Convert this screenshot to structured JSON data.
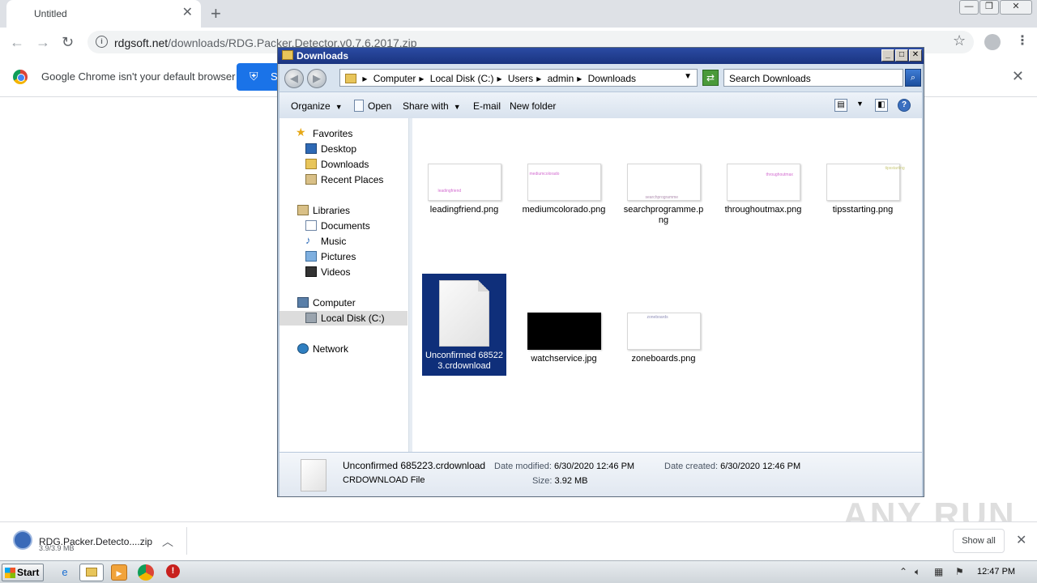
{
  "chrome": {
    "tab_title": "Untitled",
    "tab_close": "✕",
    "new_tab": "+",
    "url_host": "rdgsoft.net",
    "url_path": "/downloads/RDG.Packer.Detector.v0.7.6.2017.zip",
    "infobar_message": "Google Chrome isn't your default browser",
    "infobar_button": "S",
    "infobar_close": "✕",
    "win_minimize": "—",
    "win_restore": "❐",
    "win_close": "✕"
  },
  "download_shelf": {
    "file_name": "RDG.Packer.Detecto....zip",
    "file_size": "3.9/3.9 MB",
    "show_all": "Show all",
    "close": "✕"
  },
  "watermark": "ANY RUN",
  "explorer": {
    "title": "Downloads",
    "breadcrumb": [
      "Computer",
      "Local Disk (C:)",
      "Users",
      "admin",
      "Downloads"
    ],
    "search_placeholder": "Search Downloads",
    "toolbar": {
      "organize": "Organize",
      "open": "Open",
      "share_with": "Share with",
      "email": "E-mail",
      "new_folder": "New folder"
    },
    "nav": {
      "favorites": "Favorites",
      "desktop": "Desktop",
      "downloads": "Downloads",
      "recent_places": "Recent Places",
      "libraries": "Libraries",
      "documents": "Documents",
      "music": "Music",
      "pictures": "Pictures",
      "videos": "Videos",
      "computer": "Computer",
      "local_disk": "Local Disk (C:)",
      "network": "Network"
    },
    "files": [
      {
        "name": "leadingfriend.png",
        "thumb_text": "leadingfriend"
      },
      {
        "name": "mediumcolorado.png",
        "thumb_text": "mediumcolorado"
      },
      {
        "name": "searchprogramme.png",
        "thumb_text": "searchprogramme"
      },
      {
        "name": "throughoutmax.png",
        "thumb_text": "throughoutmax"
      },
      {
        "name": "tipsstarting.png",
        "thumb_text": "tipsstarting"
      },
      {
        "name": "Unconfirmed 685223.crdownload",
        "thumb_text": ""
      },
      {
        "name": "watchservice.jpg",
        "thumb_text": ""
      },
      {
        "name": "zoneboards.png",
        "thumb_text": "zoneboards"
      }
    ],
    "status": {
      "file_name": "Unconfirmed 685223.crdownload",
      "file_type": "CRDOWNLOAD File",
      "date_modified_label": "Date modified:",
      "date_modified": "6/30/2020 12:46 PM",
      "date_created_label": "Date created:",
      "date_created": "6/30/2020 12:46 PM",
      "size_label": "Size:",
      "size": "3.92 MB"
    }
  },
  "taskbar": {
    "start": "Start",
    "time": "12:47 PM"
  },
  "colors": {
    "selection": "#0f2f7a",
    "titlebar": "#1f3b8f",
    "chrome_blue": "#1a73e8"
  }
}
